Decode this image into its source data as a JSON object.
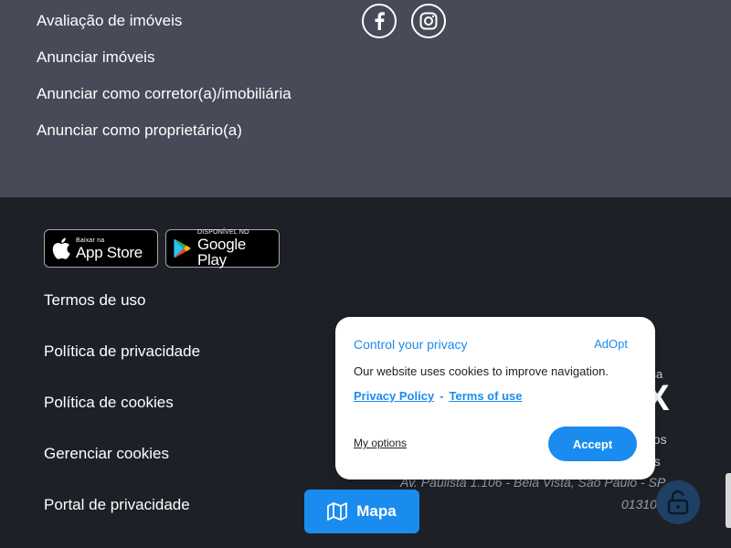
{
  "top_links": [
    "Avaliação de imóveis",
    "Anunciar imóveis",
    "Anunciar como corretor(a)/imobiliária",
    "Anunciar como proprietário(a)"
  ],
  "social": [
    "facebook-icon",
    "instagram-icon"
  ],
  "store_badges": {
    "app_store": {
      "small": "Baixar na",
      "big": "App Store"
    },
    "google_play": {
      "small": "DISPONÍVEL NO",
      "big": "Google Play"
    }
  },
  "bottom_links": [
    "Termos de uso",
    "Política de privacidade",
    "Política de cookies",
    "Gerenciar cookies",
    "Portal de privacidade"
  ],
  "company": {
    "tag": "resa",
    "logo": "X",
    "rights_line1": "eitos",
    "rights_line2": "dos",
    "address_line1": "Av. Paulista 1.106 - Bela Vista, São Paulo - SP,",
    "address_line2": "01310-914"
  },
  "map_button": {
    "label": "Mapa",
    "icon": "map-icon"
  },
  "cookie_modal": {
    "title": "Control your privacy",
    "brand": "AdOpt",
    "text": "Our website uses cookies to improve navigation.",
    "privacy_policy": "Privacy Policy",
    "separator": "-",
    "terms_of_use": "Terms of use",
    "my_options": "My options",
    "accept": "Accept"
  },
  "colors": {
    "accent": "#1a8cf0",
    "top_bg": "#474a57",
    "bottom_bg": "#1e2028"
  }
}
